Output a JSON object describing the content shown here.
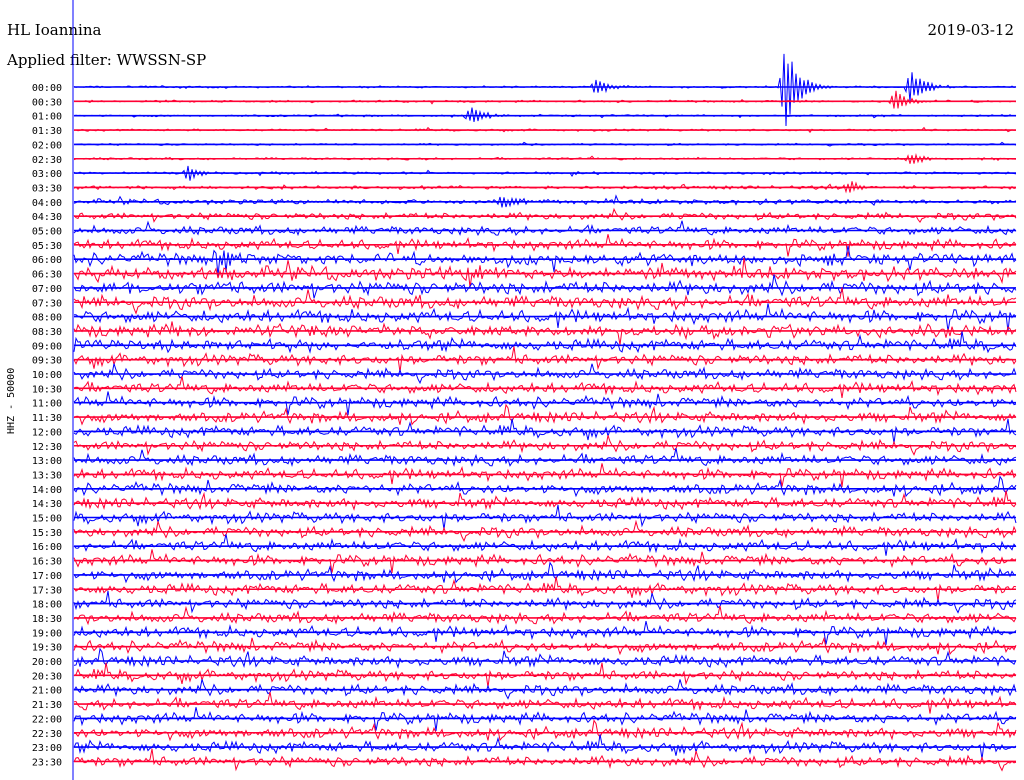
{
  "header": {
    "station": "HL Ioannina",
    "date": "2019-03-12",
    "filter_label": "Applied filter: WWSSN-SP"
  },
  "chart_data": {
    "type": "line",
    "title": "HL Ioannina",
    "subtitle": "Applied filter: WWSSN-SP",
    "ylabel": "HHZ - 50000",
    "xlabel": "",
    "grid": false,
    "line_minutes": 30,
    "trace_colors": [
      "#0000ff",
      "#ff0033"
    ],
    "categories": [
      "00:00",
      "00:30",
      "01:00",
      "01:30",
      "02:00",
      "02:30",
      "03:00",
      "03:30",
      "04:00",
      "04:30",
      "05:00",
      "05:30",
      "06:00",
      "06:30",
      "07:00",
      "07:30",
      "08:00",
      "08:30",
      "09:00",
      "09:30",
      "10:00",
      "10:30",
      "11:00",
      "11:30",
      "12:00",
      "12:30",
      "13:00",
      "13:30",
      "14:00",
      "14:30",
      "15:00",
      "15:30",
      "16:00",
      "16:30",
      "17:00",
      "17:30",
      "18:00",
      "18:30",
      "19:00",
      "19:30",
      "20:00",
      "20:30",
      "21:00",
      "21:30",
      "22:00",
      "22:30",
      "23:00",
      "23:30"
    ],
    "noise_level": [
      0.8,
      0.8,
      0.8,
      0.8,
      0.8,
      0.9,
      1.0,
      1.4,
      2.0,
      2.8,
      3.4,
      4.0,
      4.6,
      5.2,
      5.4,
      5.2,
      5.0,
      4.8,
      4.6,
      4.4,
      4.2,
      4.2,
      4.2,
      4.2,
      4.2,
      4.2,
      4.2,
      4.2,
      4.2,
      4.2,
      4.2,
      4.2,
      4.2,
      4.2,
      4.2,
      4.2,
      4.2,
      4.2,
      4.2,
      4.2,
      4.2,
      4.2,
      4.2,
      4.2,
      4.2,
      4.2,
      4.2,
      4.2
    ],
    "events": [
      {
        "line": "00:00",
        "minute": 16.5,
        "amplitude": 10
      },
      {
        "line": "00:00",
        "minute": 22.5,
        "amplitude": 55
      },
      {
        "line": "00:00",
        "minute": 26.5,
        "amplitude": 22
      },
      {
        "line": "00:30",
        "minute": 26.0,
        "amplitude": 12
      },
      {
        "line": "01:00",
        "minute": 12.5,
        "amplitude": 10
      },
      {
        "line": "02:30",
        "minute": 26.5,
        "amplitude": 8
      },
      {
        "line": "03:00",
        "minute": 3.5,
        "amplitude": 8
      },
      {
        "line": "03:30",
        "minute": 24.5,
        "amplitude": 7
      },
      {
        "line": "04:00",
        "minute": 13.5,
        "amplitude": 9
      },
      {
        "line": "06:00",
        "minute": 4.5,
        "amplitude": 14
      },
      {
        "line": "06:30",
        "minute": 12.5,
        "amplitude": 12
      },
      {
        "line": "08:30",
        "minute": 3.0,
        "amplitude": 8
      }
    ]
  }
}
